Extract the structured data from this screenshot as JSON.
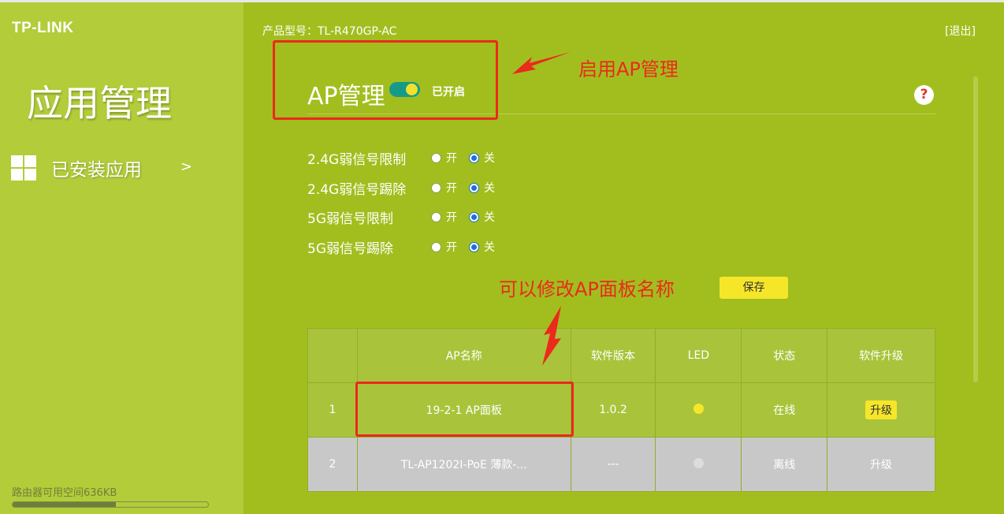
{
  "sidebar": {
    "logo": "TP-LINK",
    "title": "应用管理",
    "installed_label": "已安装应用",
    "arrow": ">",
    "storage_label": "路由器可用空间636KB",
    "storage_fill": 0.53
  },
  "header": {
    "model": "产品型号：TL-R470GP-AC",
    "logout": "[退出]"
  },
  "section": {
    "title": "AP管理",
    "toggle_on": true,
    "toggle_status": "已开启",
    "help": "?"
  },
  "options": [
    {
      "label": "2.4G弱信号限制",
      "on_label": "开",
      "off_label": "关",
      "value": "off"
    },
    {
      "label": "2.4G弱信号踢除",
      "on_label": "开",
      "off_label": "关",
      "value": "off"
    },
    {
      "label": "5G弱信号限制",
      "on_label": "开",
      "off_label": "关",
      "value": "off"
    },
    {
      "label": "5G弱信号踢除",
      "on_label": "开",
      "off_label": "关",
      "value": "off"
    }
  ],
  "save_label": "保存",
  "table": {
    "headers": [
      "",
      "AP名称",
      "软件版本",
      "LED",
      "状态",
      "软件升级"
    ],
    "rows": [
      {
        "index": "1",
        "name": "19-2-1 AP面板",
        "version": "1.0.2",
        "led": "on",
        "status": "在线",
        "upgrade": "升级"
      },
      {
        "index": "2",
        "name": "TL-AP1202I-PoE 薄款-...",
        "version": "---",
        "led": "off",
        "status": "离线",
        "upgrade": "升级"
      }
    ]
  },
  "annotations": {
    "enable_ap": "启用AP管理",
    "rename_ap": "可以修改AP面板名称"
  },
  "colors": {
    "main_bg": "#a2be1e",
    "sidebar_bg": "#b2cc3a",
    "accent_yellow": "#f6e62a",
    "toggle_teal": "#179a88",
    "annotation_red": "#ea2a1c"
  }
}
